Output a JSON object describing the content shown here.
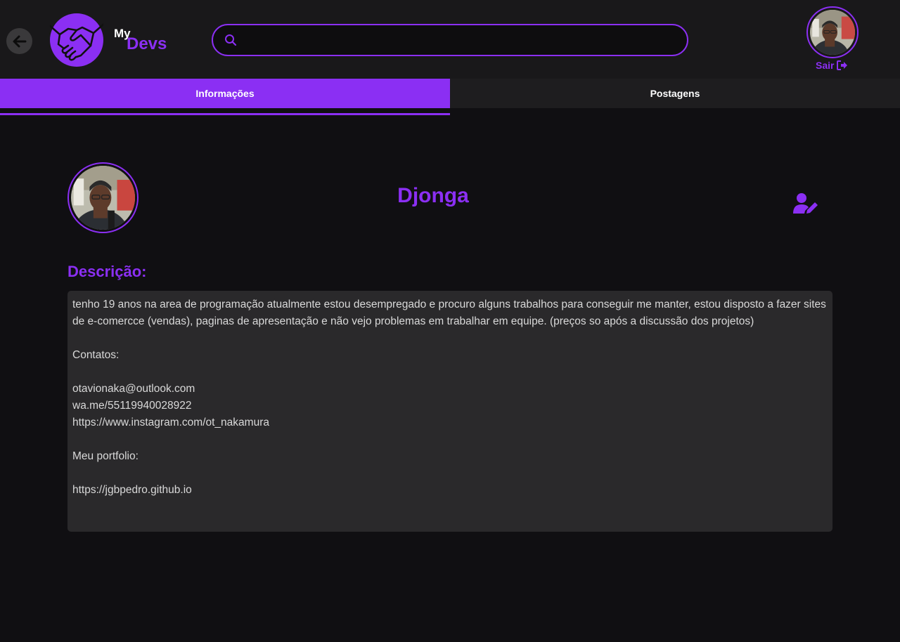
{
  "header": {
    "logo_my": "My",
    "logo_devs": "Devs",
    "search": {
      "placeholder": "",
      "value": ""
    },
    "logout_label": "Sair"
  },
  "tabs": [
    {
      "label": "Informações",
      "active": true
    },
    {
      "label": "Postagens",
      "active": false
    }
  ],
  "profile": {
    "name": "Djonga",
    "description_title": "Descrição:",
    "description": "tenho 19 anos na area de programação atualmente estou desempregado e procuro alguns trabalhos para conseguir me manter, estou disposto a fazer sites de e-comercce (vendas), paginas de apresentação e não vejo problemas em trabalhar em equipe. (preços so após a discussão dos projetos)\n\nContatos:\n\notavionaka@outlook.com\nwa.me/55119940028922\nhttps://www.instagram.com/ot_nakamura\n\nMeu portfolio:\n\nhttps://jgbpedro.github.io"
  },
  "colors": {
    "accent": "#8b2ff3",
    "background": "#100f12",
    "header_bg": "#19181a",
    "box_bg": "#2a292b"
  },
  "icons": [
    "arrow-left-icon",
    "handshake-icon",
    "search-icon",
    "logout-icon",
    "user-edit-icon"
  ]
}
